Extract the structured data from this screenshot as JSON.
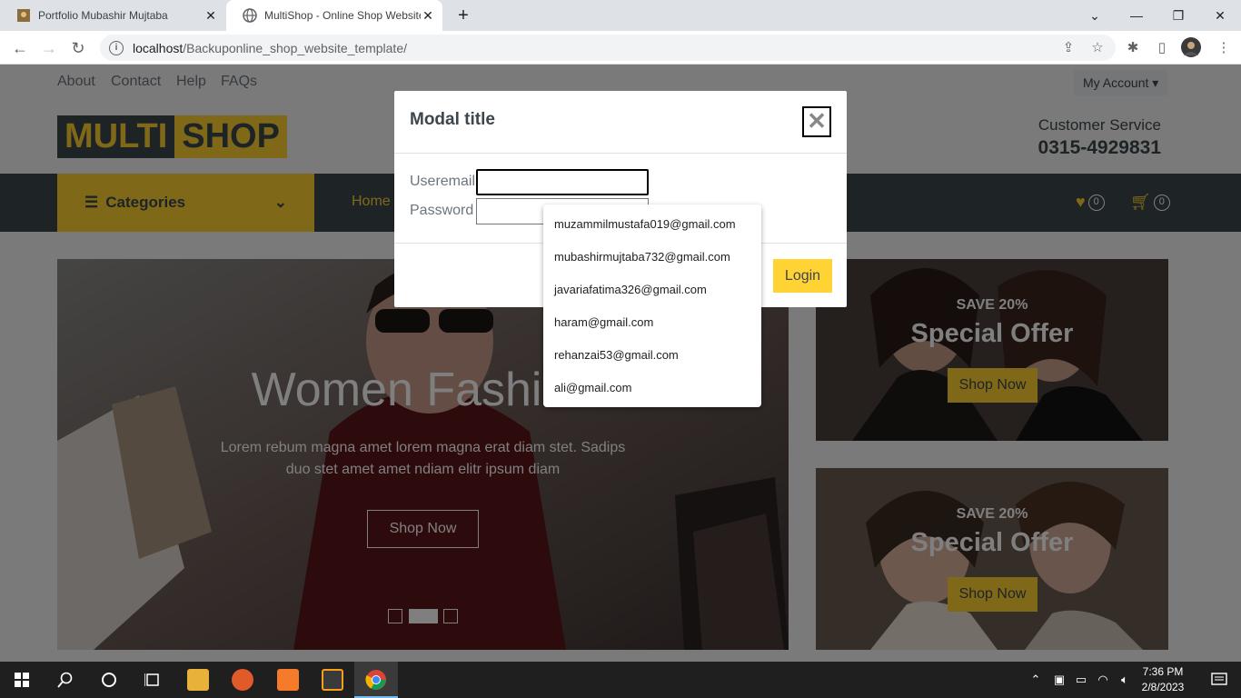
{
  "browser": {
    "tabs": [
      {
        "title": "Portfolio Mubashir Mujtaba",
        "active": false
      },
      {
        "title": "MultiShop - Online Shop Website",
        "active": true
      }
    ],
    "url_host": "localhost",
    "url_path": "/Backuponline_shop_website_template/"
  },
  "topbar": {
    "links": [
      "About",
      "Contact",
      "Help",
      "FAQs"
    ],
    "my_account": "My Account ▾"
  },
  "header": {
    "logo_part1": "MULTI",
    "logo_part2": "SHOP",
    "cs_label": "Customer Service",
    "cs_phone": "0315-4929831"
  },
  "nav": {
    "categories_label": "Categories",
    "home": "Home",
    "wishlist_count": "0",
    "cart_count": "0"
  },
  "hero": {
    "title": "Women Fashion",
    "text": "Lorem rebum magna amet lorem magna erat diam stet. Sadips duo stet amet amet ndiam elitr ipsum diam",
    "button": "Shop Now"
  },
  "offers": [
    {
      "save": "SAVE 20%",
      "title": "Special Offer",
      "button": "Shop Now"
    },
    {
      "save": "SAVE 20%",
      "title": "Special Offer",
      "button": "Shop Now"
    }
  ],
  "modal": {
    "title": "Modal title",
    "close": "✕",
    "email_label": "Useremail",
    "password_label": "Password",
    "login_button": "Login"
  },
  "autocomplete": [
    "muzammilmustafa019@gmail.com",
    "mubashirmujtaba732@gmail.com",
    "javariafatima326@gmail.com",
    "haram@gmail.com",
    "rehanzai53@gmail.com",
    "ali@gmail.com"
  ],
  "taskbar": {
    "time": "7:36 PM",
    "date": "2/8/2023"
  },
  "colors": {
    "primary": "#ffd333",
    "dark": "#3d464d"
  }
}
